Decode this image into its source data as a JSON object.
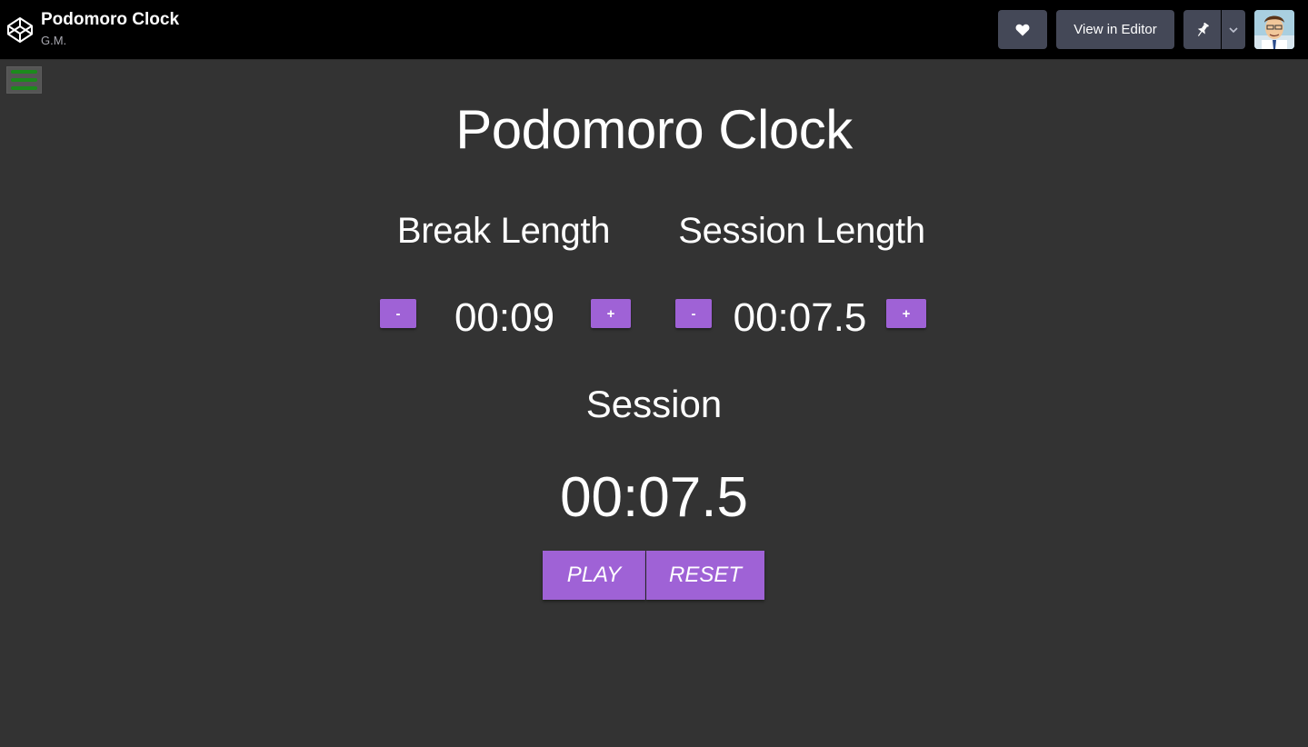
{
  "header": {
    "pen_title": "Podomoro Clock",
    "author": "G.M.",
    "view_in_editor_label": "View in Editor",
    "icons": [
      "codepen-logo-icon",
      "heart-icon",
      "pin-icon",
      "chevron-down-icon",
      "avatar"
    ]
  },
  "app": {
    "title": "Podomoro Clock",
    "break": {
      "label": "Break Length",
      "minus_label": "-",
      "plus_label": "+",
      "value": "00:09"
    },
    "session": {
      "label": "Session Length",
      "minus_label": "-",
      "plus_label": "+",
      "value": "00:07.5"
    },
    "timer": {
      "label": "Session",
      "value": "00:07.5"
    },
    "controls": {
      "play_label": "PLAY",
      "reset_label": "RESET"
    }
  },
  "colors": {
    "background": "#333333",
    "topbar": "#000000",
    "accent": "#9f62d6",
    "header_button": "#444857",
    "hamburger_bars": "#1c8a1c"
  }
}
